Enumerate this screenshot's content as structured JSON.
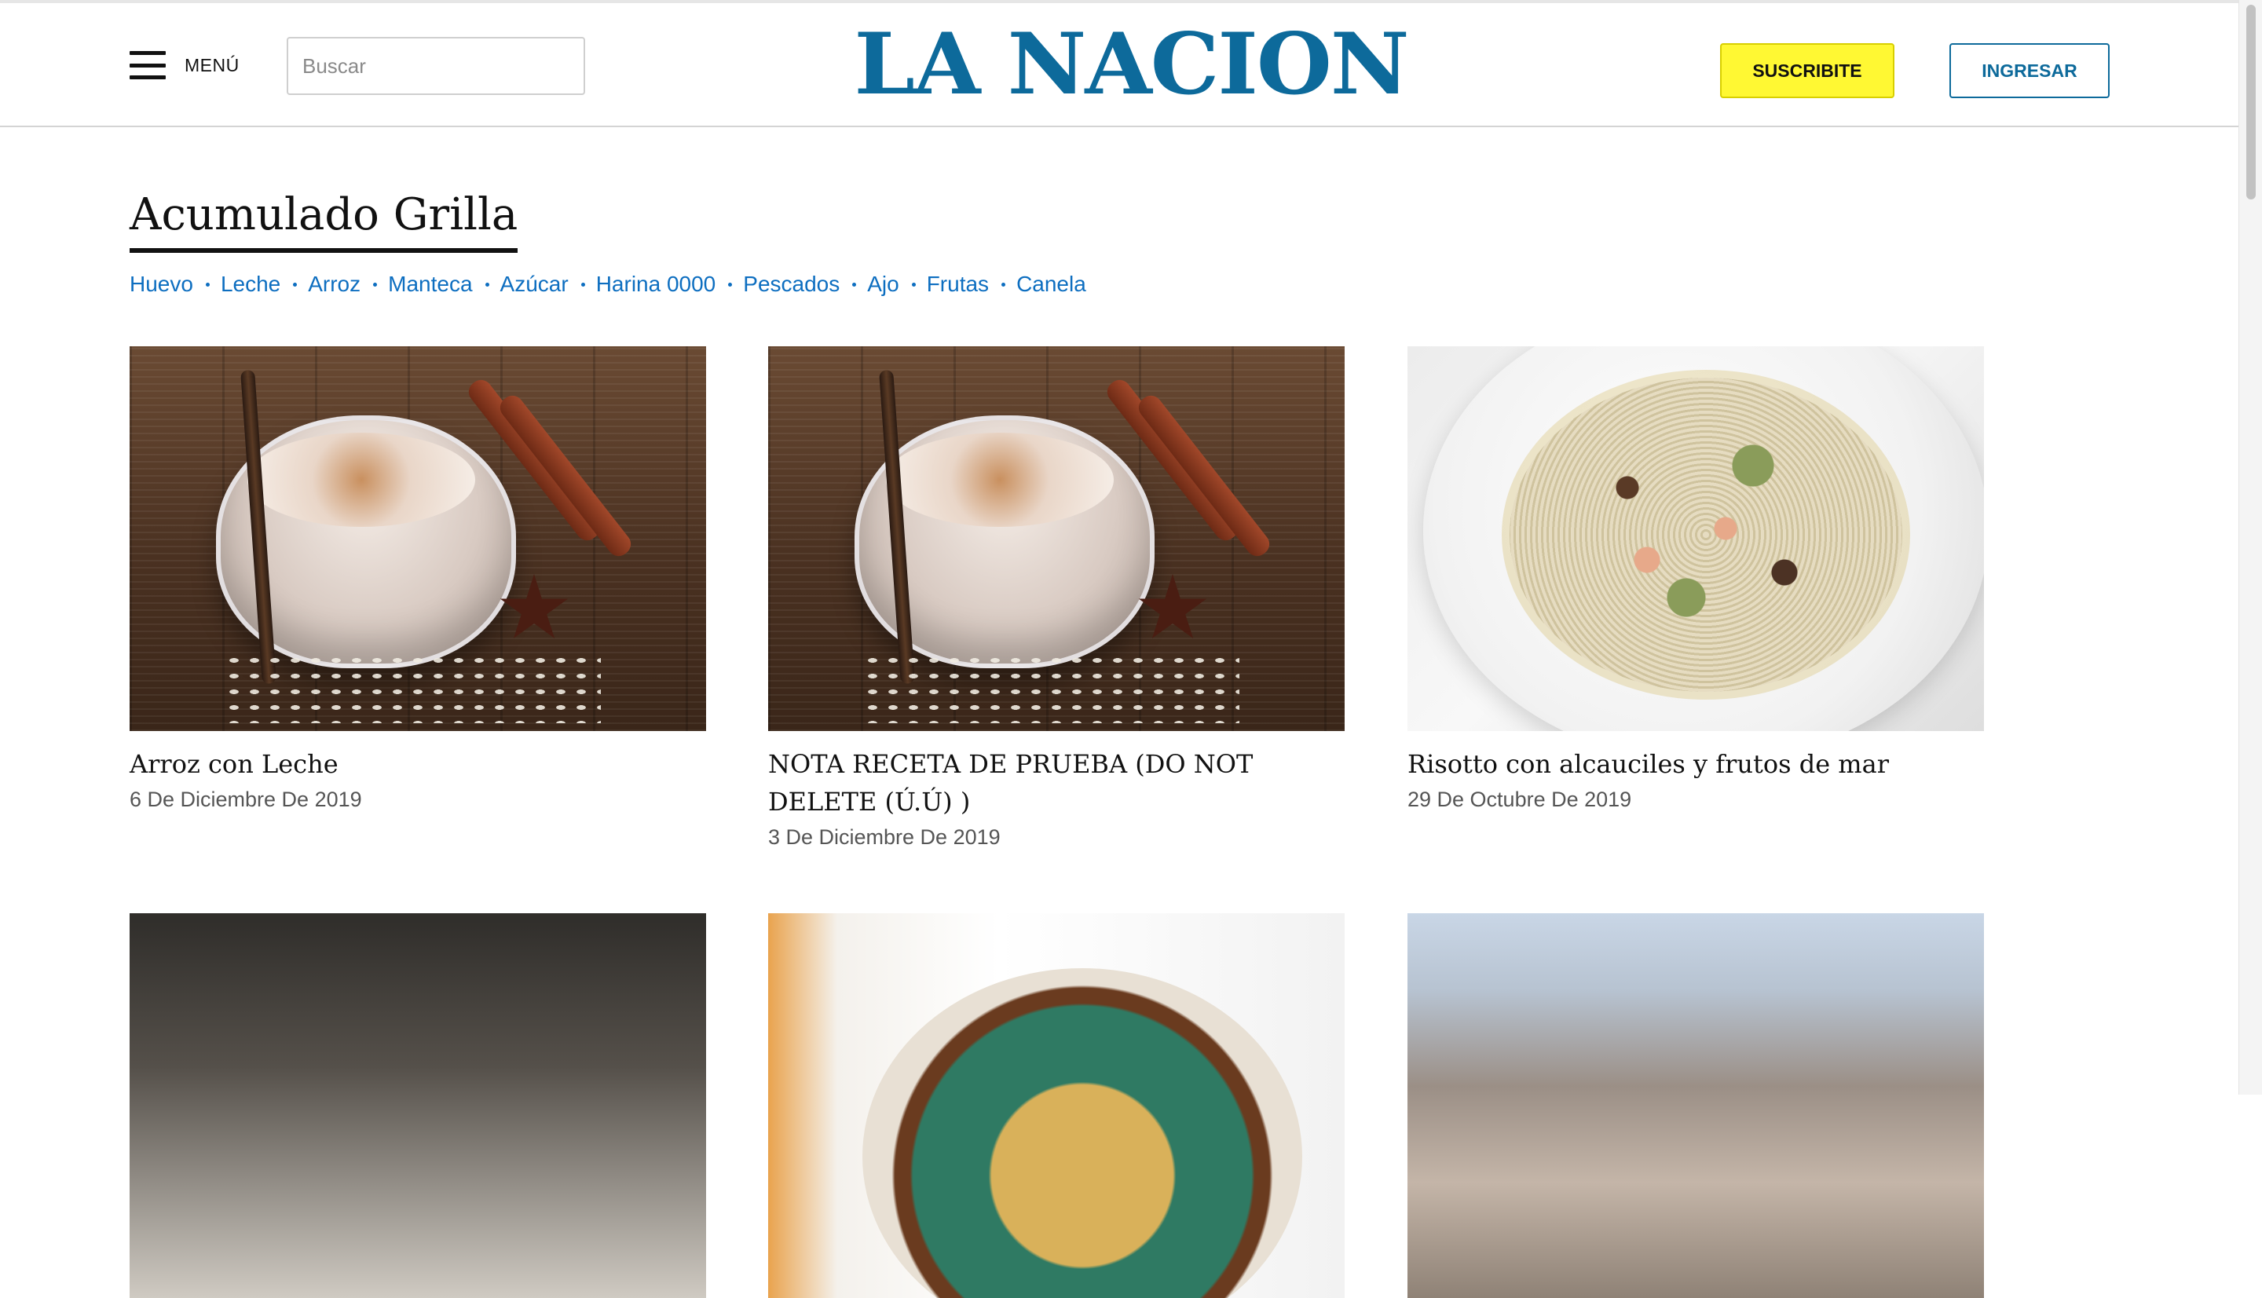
{
  "header": {
    "menu_label": "MENÚ",
    "search_placeholder": "Buscar",
    "search_value": "",
    "logo_text": "LA NACION",
    "subscribe_label": "SUSCRIBITE",
    "login_label": "INGRESAR"
  },
  "page": {
    "title": "Acumulado Grilla",
    "tags": [
      "Huevo",
      "Leche",
      "Arroz",
      "Manteca",
      "Azúcar",
      "Harina 0000",
      "Pescados",
      "Ajo",
      "Frutas",
      "Canela"
    ]
  },
  "cards": [
    {
      "title": "Arroz con Leche",
      "date": "6 De Diciembre De 2019",
      "image": "arroz-con-leche-photo"
    },
    {
      "title": "NOTA RECETA DE PRUEBA (DO NOT DELETE (Ú.Ú) )",
      "date": "3 De Diciembre De 2019",
      "image": "arroz-con-leche-photo"
    },
    {
      "title": "Risotto con alcauciles y frutos de mar",
      "date": "29 De Octubre De 2019",
      "image": "risotto-photo"
    },
    {
      "title": "",
      "date": "",
      "image": "restaurant-dish-photo"
    },
    {
      "title": "",
      "date": "",
      "image": "seafood-bowl-photo"
    },
    {
      "title": "",
      "date": "",
      "image": "city-skyline-photo"
    }
  ],
  "colors": {
    "brand": "#0d6a9b",
    "link": "#0d6ec0",
    "subscribe_bg": "#fff833"
  }
}
